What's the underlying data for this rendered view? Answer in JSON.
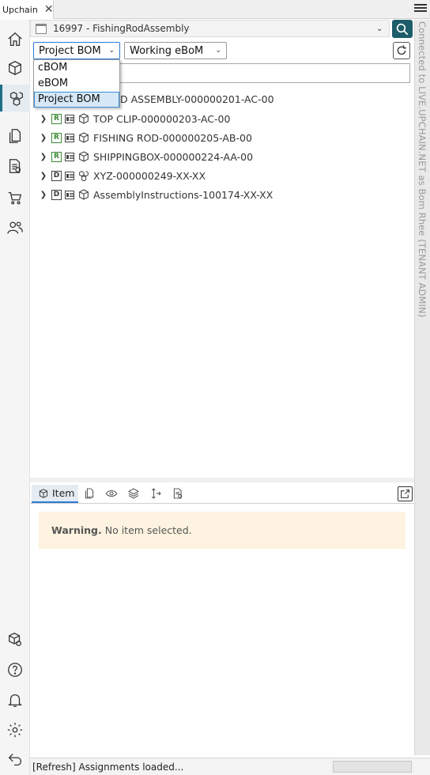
{
  "window": {
    "tab_label": "Upchain"
  },
  "header": {
    "project_name": "16997 - FishingRodAssembly",
    "bom_type_selected": "Project BOM",
    "view_selected": "Working eBoM",
    "connection_status": "Connected to LIVE.UPCHAIN.NET as Bom Rhee (TENANT ADMIN)"
  },
  "bom_dropdown": {
    "options": [
      "cBOM",
      "eBOM",
      "Project BOM"
    ],
    "selected_index": 2
  },
  "tree": {
    "root_label_visible": "D ASSEMBLY-000000201-AC-00",
    "items": [
      {
        "status": "R",
        "label": "TOP CLIP-000000203-AC-00",
        "icon": "part-cube-icon"
      },
      {
        "status": "R",
        "label": "FISHING ROD-000000205-AB-00",
        "icon": "part-cube-icon"
      },
      {
        "status": "R",
        "label": "SHIPPINGBOX-000000224-AA-00",
        "icon": "part-cube-icon"
      },
      {
        "status": "D",
        "label": "XYZ-000000249-XX-XX",
        "icon": "assembly-icon"
      },
      {
        "status": "D",
        "label": "AssemblyInstructions-100174-XX-XX",
        "icon": "part-cube-icon"
      }
    ]
  },
  "details": {
    "item_tab_label": "Item",
    "warning_title": "Warning.",
    "warning_text": "No item selected."
  },
  "status": {
    "message": "[Refresh] Assignments loaded..."
  },
  "colors": {
    "accent": "#1d5c69",
    "select_blue": "#2b7bd6",
    "released_green": "#3a8a34",
    "warning_bg": "#fdf3e0"
  }
}
